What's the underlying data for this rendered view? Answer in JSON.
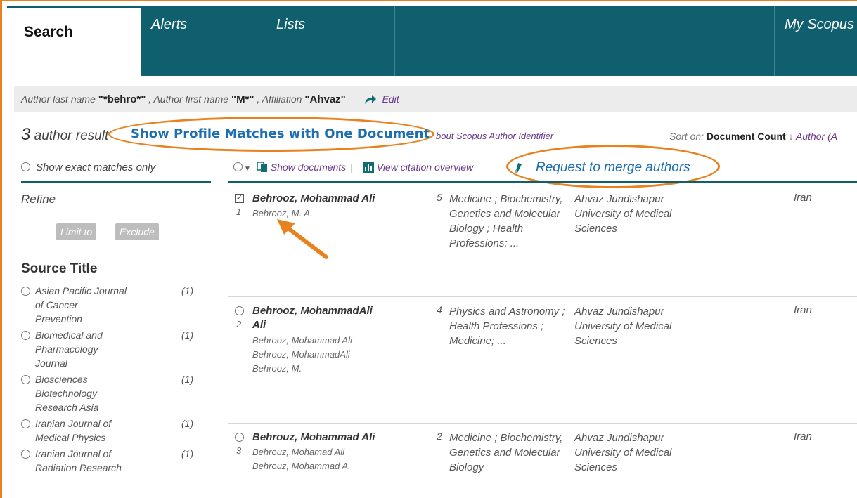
{
  "nav": {
    "tabs": [
      {
        "label": "Search"
      },
      {
        "label": "Alerts"
      },
      {
        "label": "Lists"
      },
      {
        "label": "My Scopus"
      }
    ]
  },
  "query": {
    "part1": "Author last name ",
    "last_name": "\"*behro*\"",
    "part2": " , Author first name ",
    "first_name": "\"M*\"",
    "part3": " , Affiliation ",
    "affiliation": "\"Ahvaz\"",
    "edit_label": "Edit"
  },
  "results": {
    "count": "3",
    "text": " author result",
    "about_link": "bout Scopus Author Identifier",
    "sort_label": "Sort on: ",
    "sort_active": "Document Count",
    "sort_arrow": "↓",
    "sort_other": "Author (A"
  },
  "annotations": {
    "profile_matches": "Show Profile Matches with One Document",
    "merge": "Request to merge authors"
  },
  "toolbar": {
    "exact_label": "Show exact matches only",
    "show_documents": "Show documents",
    "view_citation": "View citation overview"
  },
  "sidebar": {
    "refine": "Refine",
    "limit_to": "Limit to",
    "exclude": "Exclude",
    "source_title": "Source Title",
    "sources": [
      {
        "name": "Asian Pacific Journal of Cancer Prevention",
        "count": "(1)"
      },
      {
        "name": "Biomedical and Pharmacology Journal",
        "count": "(1)"
      },
      {
        "name": "Biosciences Biotechnology Research Asia",
        "count": "(1)"
      },
      {
        "name": "Iranian Journal of Medical Physics",
        "count": "(1)"
      },
      {
        "name": "Iranian Journal of Radiation Research",
        "count": "(1)"
      }
    ]
  },
  "authors": [
    {
      "num": "1",
      "name": "Behrooz, Mohammad Ali",
      "variants": [
        "Behrooz, M. A."
      ],
      "documents": "5",
      "subjects": "Medicine ; Biochemistry, Genetics and Molecular Biology ; Health Professions; ...",
      "affiliation": "Ahvaz Jundishapur University of Medical Sciences",
      "country": "Iran",
      "checked": true
    },
    {
      "num": "2",
      "name": "Behrooz, MohammadAli Ali",
      "variants": [
        "Behrooz, Mohammad Ali",
        "Behrooz, MohammadAli",
        "Behrooz, M."
      ],
      "documents": "4",
      "subjects": "Physics and Astronomy ; Health Professions ; Medicine; ...",
      "affiliation": "Ahvaz Jundishapur University of Medical Sciences",
      "country": "Iran",
      "checked": false
    },
    {
      "num": "3",
      "name": "Behrouz, Mohammad Ali",
      "variants": [
        "Behrouz, Mohamad Ali",
        "Behrouz, Mohammad A."
      ],
      "documents": "2",
      "subjects": "Medicine ; Biochemistry, Genetics and Molecular Biology",
      "affiliation": "Ahvaz Jundishapur University of Medical Sciences",
      "country": "Iran",
      "checked": false
    }
  ],
  "colors": {
    "nav": "#0f5f6e",
    "accent": "#e8821e",
    "link": "#6b3a8c",
    "highlight": "#1e6fb0"
  }
}
